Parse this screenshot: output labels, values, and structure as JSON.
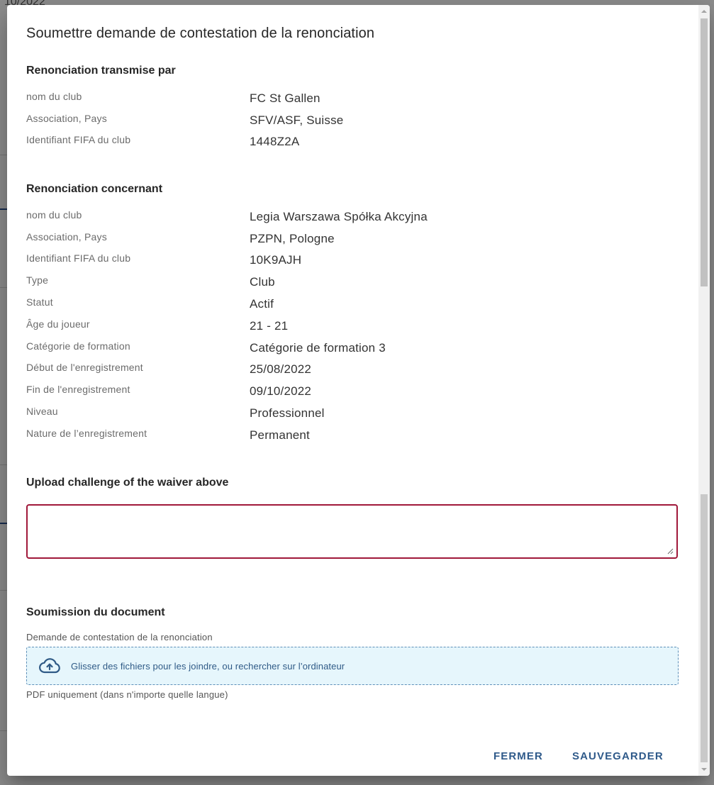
{
  "background": {
    "top_text": "10/2022"
  },
  "dialog": {
    "title": "Soumettre demande de contestation de la renonciation",
    "transmitted_by": {
      "heading": "Renonciation transmise par",
      "rows": [
        {
          "label": "nom du club",
          "value": "FC St Gallen"
        },
        {
          "label": "Association, Pays",
          "value": "SFV/ASF, Suisse"
        },
        {
          "label": "Identifiant FIFA du club",
          "value": "1448Z2A"
        }
      ]
    },
    "concerning": {
      "heading": "Renonciation concernant",
      "rows": [
        {
          "label": "nom du club",
          "value": "Legia Warszawa Spółka Akcyjna"
        },
        {
          "label": "Association, Pays",
          "value": "PZPN, Pologne"
        },
        {
          "label": "Identifiant FIFA du club",
          "value": "10K9AJH"
        },
        {
          "label": "Type",
          "value": "Club"
        },
        {
          "label": "Statut",
          "value": "Actif"
        },
        {
          "label": "Âge du joueur",
          "value": "21 - 21"
        },
        {
          "label": "Catégorie de formation",
          "value": "Catégorie de formation 3"
        },
        {
          "label": "Début de l'enregistrement",
          "value": "25/08/2022"
        },
        {
          "label": "Fin de l'enregistrement",
          "value": "09/10/2022"
        },
        {
          "label": "Niveau",
          "value": "Professionnel"
        },
        {
          "label": "Nature de l’enregistrement",
          "value": "Permanent"
        }
      ]
    },
    "challenge": {
      "heading": "Upload challenge of the waiver above",
      "textarea_value": ""
    },
    "document": {
      "heading": "Soumission du document",
      "field_label": "Demande de contestation de la renonciation",
      "dropzone_text": "Glisser des fichiers pour les joindre, ou rechercher sur l’ordinateur",
      "hint": "PDF uniquement (dans n'importe quelle langue)",
      "icon": "cloud-upload-icon"
    },
    "actions": {
      "close_label": "FERMER",
      "save_label": "SAUVEGARDER"
    }
  },
  "colors": {
    "accent": "#2f5a8a",
    "error_border": "#a0183a",
    "dropzone_bg": "#e6f6fc"
  }
}
